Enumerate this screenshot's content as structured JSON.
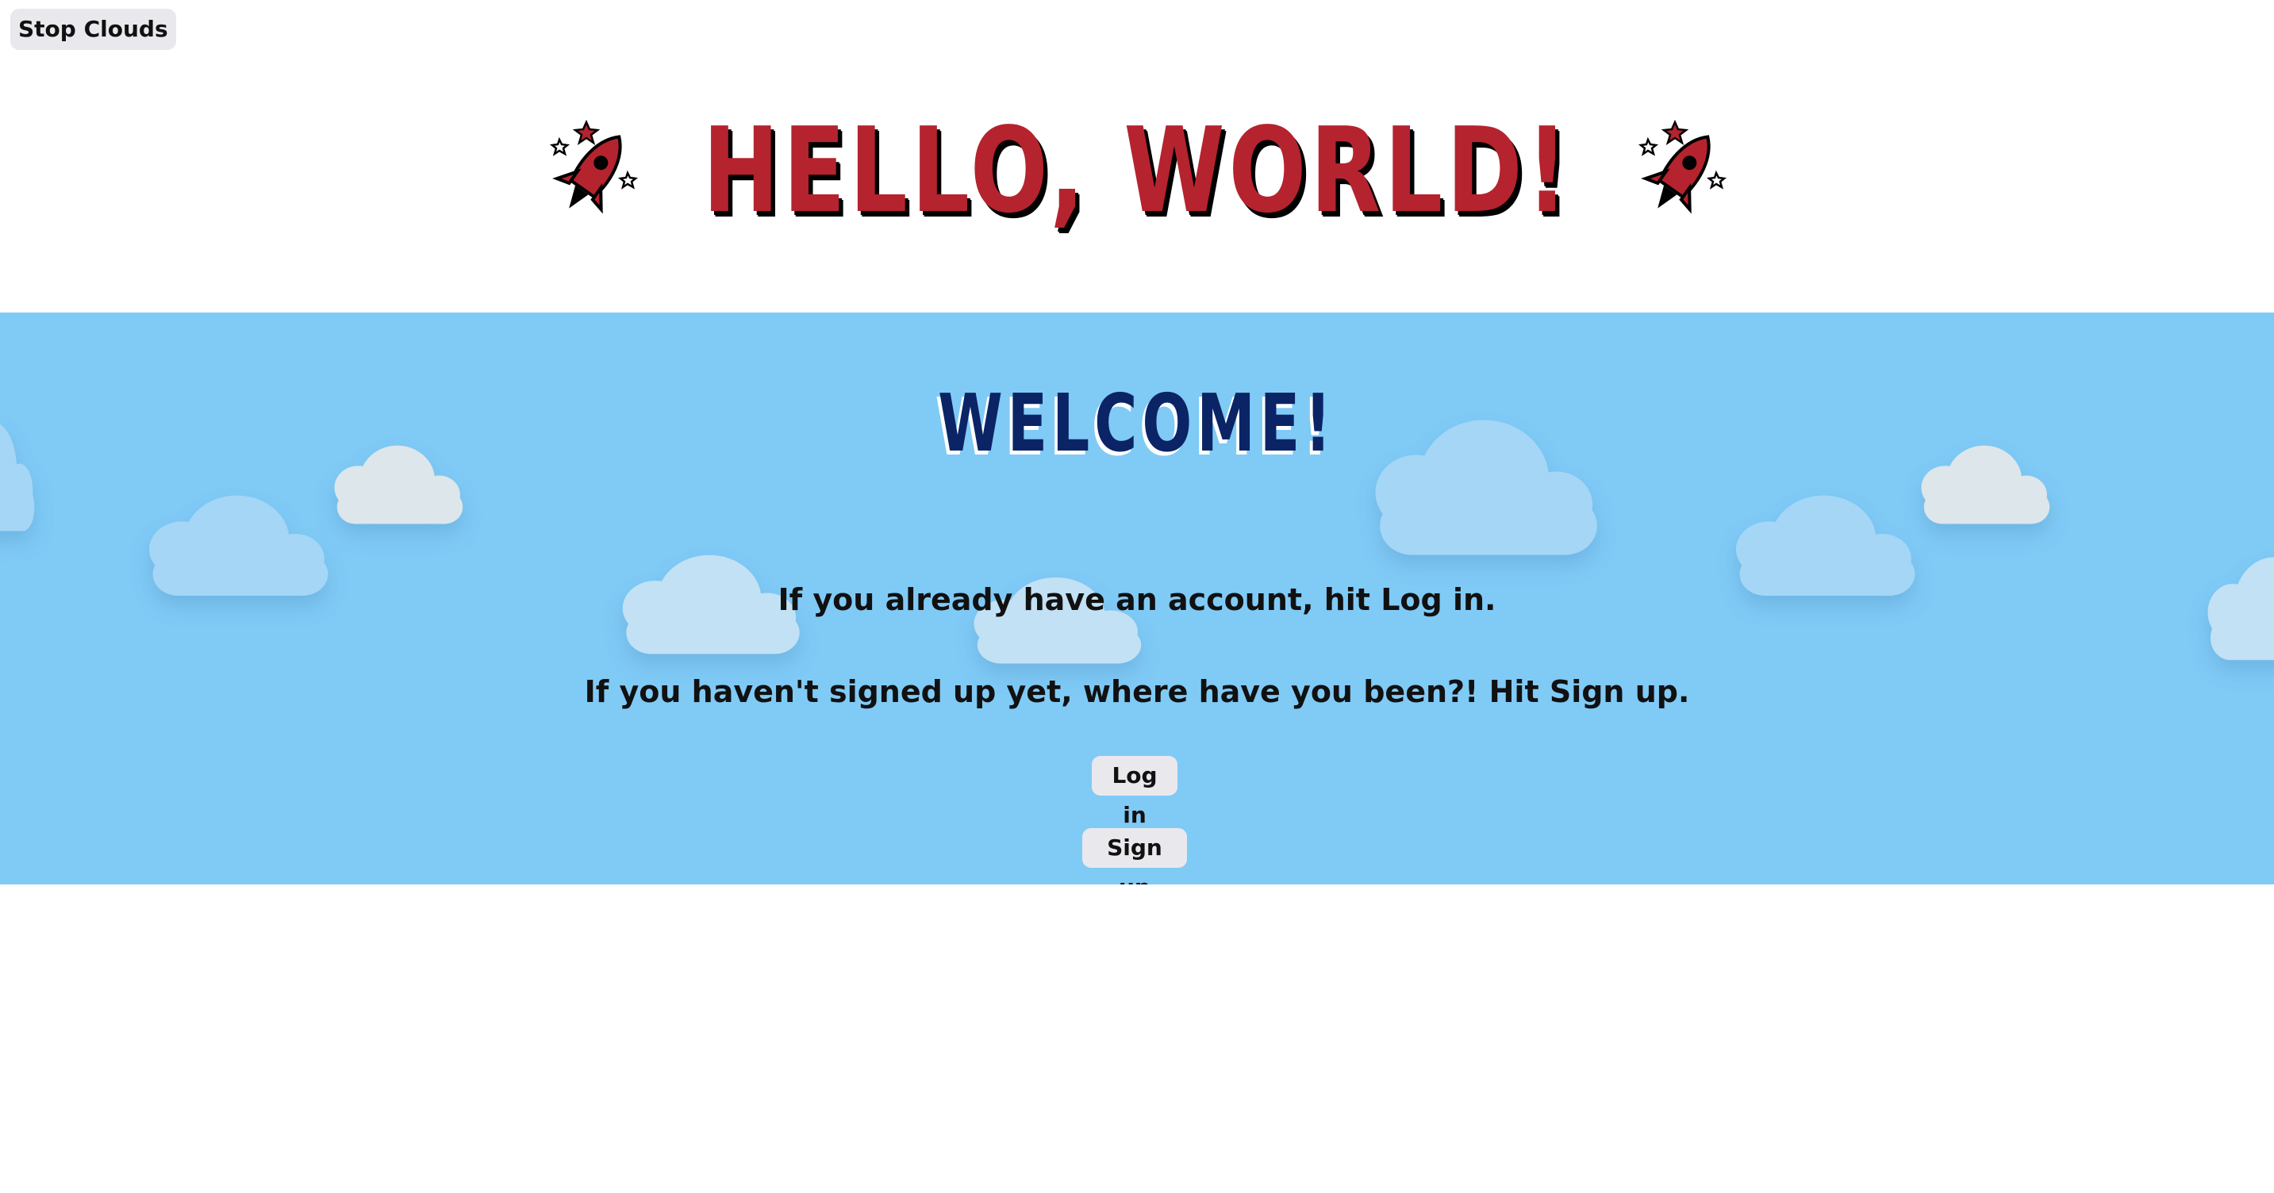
{
  "controls": {
    "stop_clouds_label": "Stop Clouds"
  },
  "header": {
    "title": "HELLO, WORLD!",
    "decoration_icon": "rocket-icon"
  },
  "welcome": {
    "heading": "WELCOME!",
    "login_message": "If you already have an account, hit Log in.",
    "signup_message": "If you haven't signed up yet, where have you been?! Hit Sign up.",
    "login_label": "Log in",
    "signup_label": "Sign up"
  },
  "colors": {
    "title_red": "#b5232f",
    "sky_blue": "#80caf6",
    "welcome_navy": "#0b2466",
    "button_gray": "#e9e9ed"
  }
}
